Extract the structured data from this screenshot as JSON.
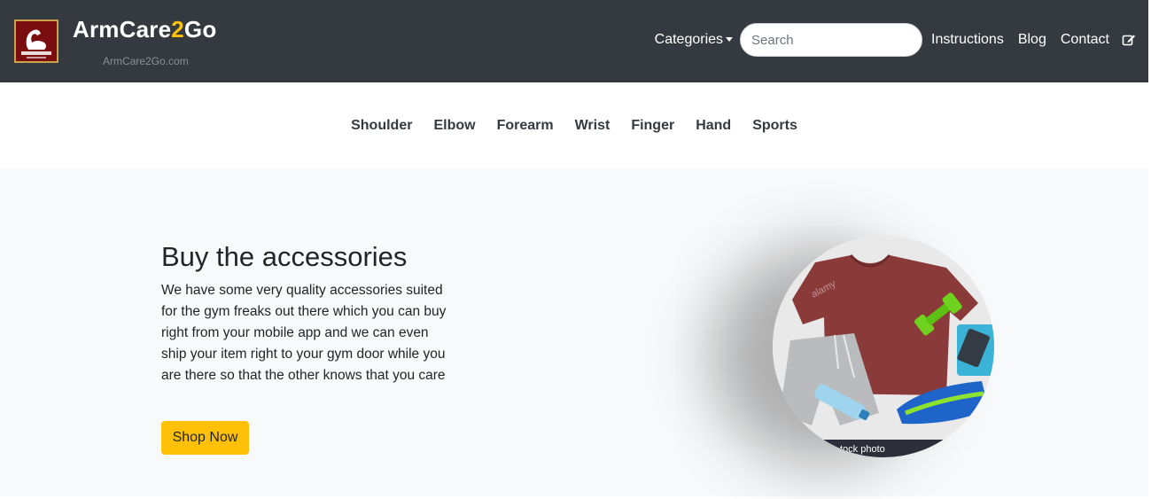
{
  "navbar": {
    "brand_prefix": "ArmCare",
    "brand_two": "2",
    "brand_suffix": "Go",
    "brand_sub": "ArmCare2Go.com",
    "categories_label": "Categories",
    "search_placeholder": "Search",
    "links": [
      "Instructions",
      "Blog",
      "Contact"
    ]
  },
  "categories": [
    "Shoulder",
    "Elbow",
    "Forearm",
    "Wrist",
    "Finger",
    "Hand",
    "Sports"
  ],
  "hero": {
    "title": "Buy the accessories",
    "text": "We have some very quality accessories suited for the gym freaks out there which you can buy right from your mobile app and we can even ship your item right to your gym door while you are there so that the other knows that you care",
    "button_label": "Shop Now",
    "image_caption": "tock photo",
    "image_watermark": "alamy"
  },
  "colors": {
    "navbar_bg": "#343a40",
    "accent": "#ffc107",
    "hero_bg": "#f8f9fa"
  },
  "icons": [
    "armcare-logo",
    "caret-down-icon",
    "edit-icon"
  ]
}
